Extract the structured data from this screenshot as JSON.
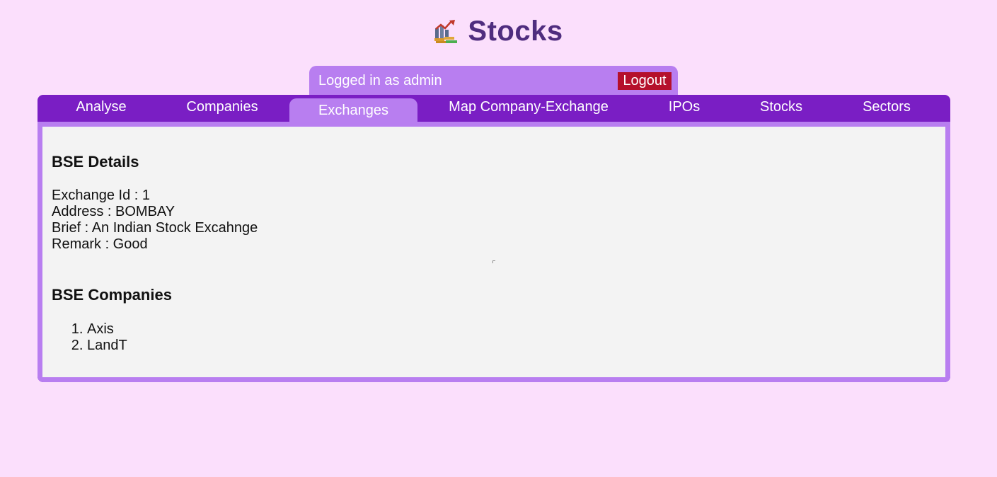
{
  "app": {
    "title": "Stocks",
    "logo_icon": "stock-chart-icon"
  },
  "userbar": {
    "logged_in_text": "Logged in as admin",
    "logout_label": "Logout"
  },
  "tabs": [
    {
      "label": "Analyse",
      "active": false
    },
    {
      "label": "Companies",
      "active": false
    },
    {
      "label": "Exchanges",
      "active": true
    },
    {
      "label": "Map Company-Exchange",
      "active": false
    },
    {
      "label": "IPOs",
      "active": false
    },
    {
      "label": "Stocks",
      "active": false
    },
    {
      "label": "Sectors",
      "active": false
    }
  ],
  "exchange": {
    "details_heading": "BSE Details",
    "id_line": "Exchange Id : 1",
    "address_line": "Address : BOMBAY",
    "brief_line": "Brief : An Indian Stock Excahnge",
    "remark_line": "Remark : Good",
    "companies_heading": "BSE Companies",
    "companies": [
      "Axis",
      "LandT"
    ]
  },
  "colors": {
    "background": "#fbdffc",
    "title": "#4f2d7f",
    "tabbar": "#7a1ec4",
    "accent": "#b87ef0",
    "logout": "#b5102b",
    "content": "#f3f3f3"
  }
}
